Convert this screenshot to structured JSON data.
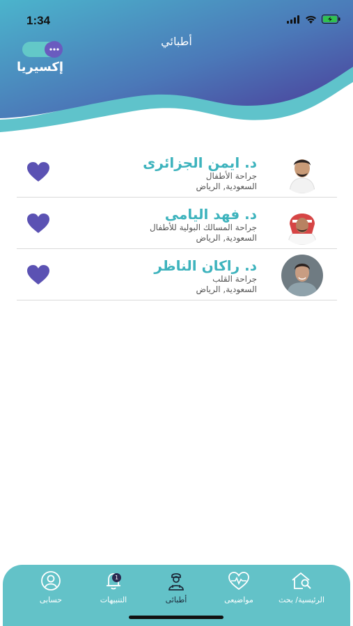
{
  "status": {
    "time": "1:34"
  },
  "header": {
    "title": "أطبائي",
    "logo_text": "إكسيريا"
  },
  "colors": {
    "accent": "#3db3bd",
    "header_top": "#4ea9c9",
    "header_bottom": "#4b3e9c",
    "heart": "#5b52b3",
    "tabbar": "#63c2c8"
  },
  "doctors": [
    {
      "name": "د. ايمن  الجزائرى",
      "specialty": "جراحة الأطفال",
      "location": "السعودية, الرياض",
      "favorite_icon": "heart-icon"
    },
    {
      "name": "د. فهد اليامى",
      "specialty": "جراحة المسالك البولية للأطفال",
      "location": "السعودية, الرياض",
      "favorite_icon": "heart-icon"
    },
    {
      "name": "د. راكان الناظر",
      "specialty": "جراحة القلب",
      "location": "السعودية, الرياض",
      "favorite_icon": "heart-icon"
    }
  ],
  "tabbar": {
    "tabs": [
      {
        "label": "الرئيسية/ بحث",
        "icon": "home-search-icon"
      },
      {
        "label": "مواضيعى",
        "icon": "heart-pulse-icon"
      },
      {
        "label": "أطبائى",
        "icon": "doctor-icon",
        "active": true
      },
      {
        "label": "التنبيهات",
        "icon": "bell-icon",
        "badge": "1"
      },
      {
        "label": "حسابى",
        "icon": "user-icon"
      }
    ]
  }
}
